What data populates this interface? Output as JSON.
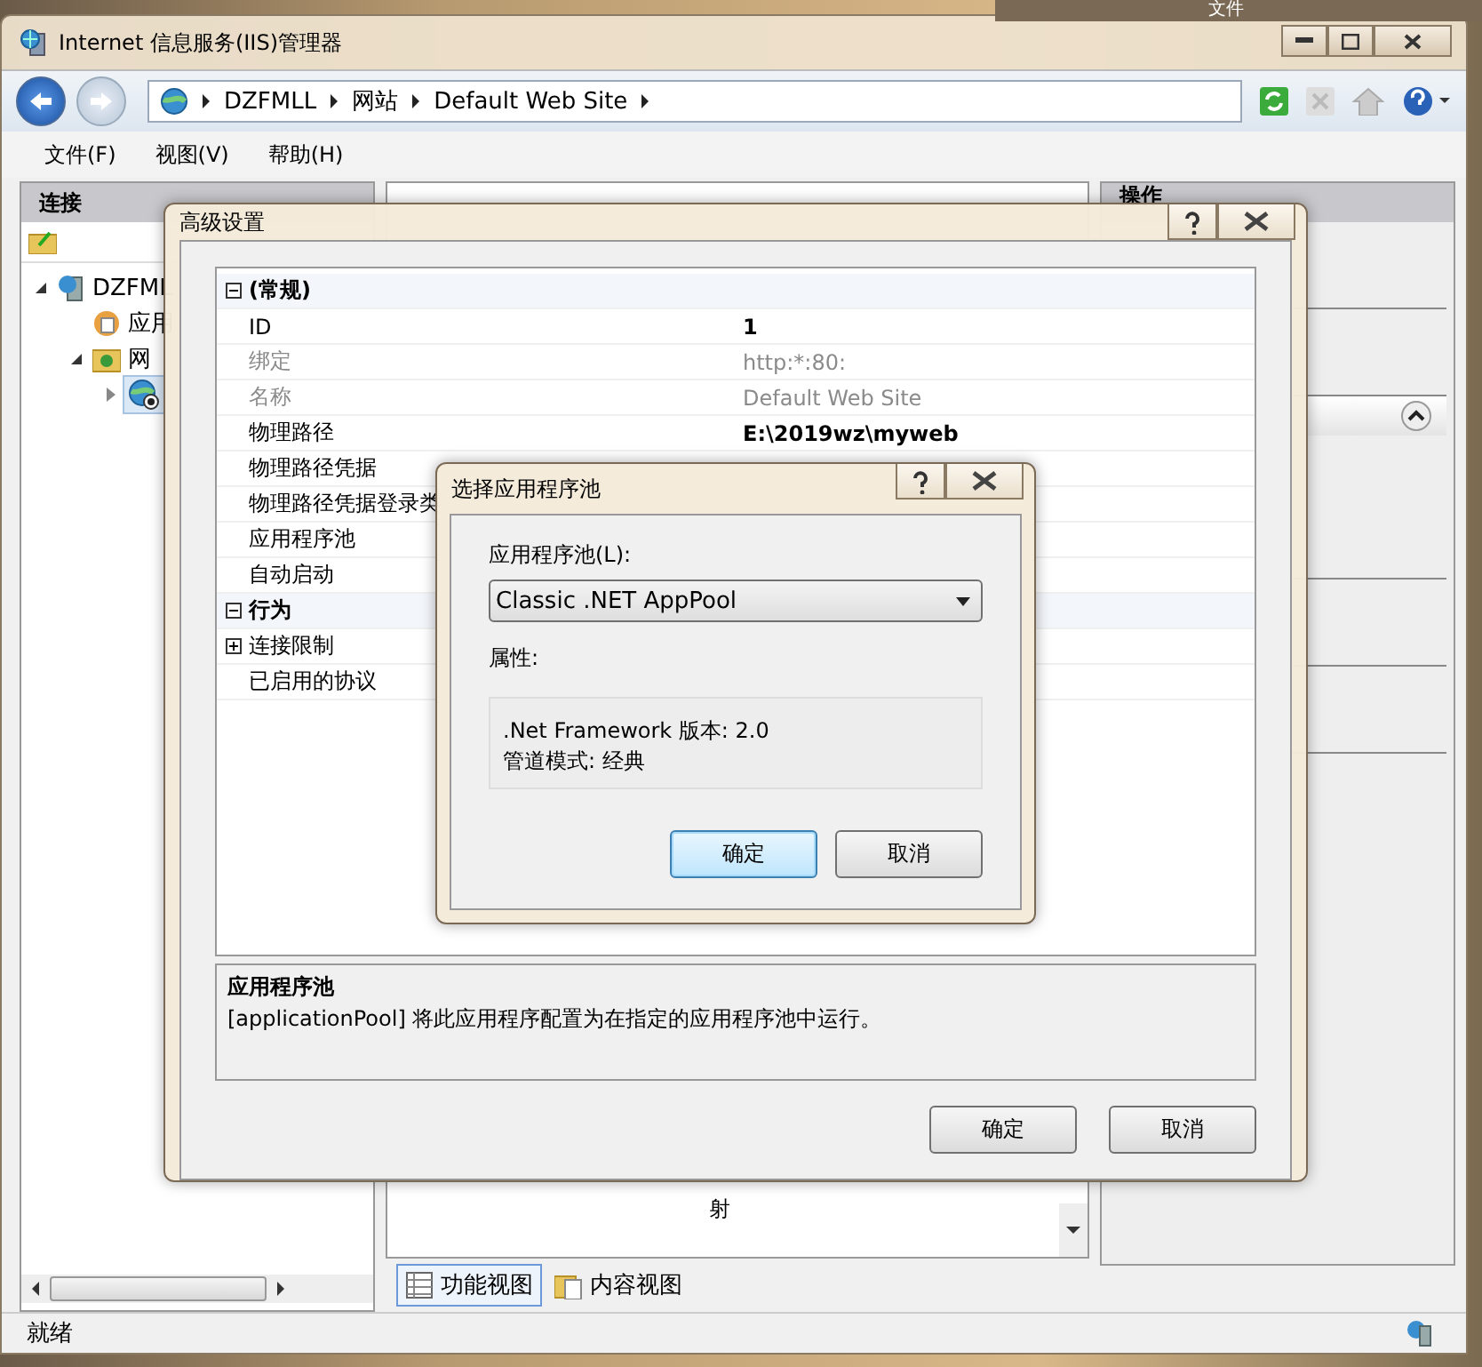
{
  "background_window": {
    "title": "文件"
  },
  "window": {
    "title": "Internet 信息服务(IIS)管理器"
  },
  "breadcrumb": [
    "DZFMLL",
    "网站",
    "Default Web Site"
  ],
  "menu": [
    "文件(F)",
    "视图(V)",
    "帮助(H)"
  ],
  "connections": {
    "title": "连接",
    "tree": [
      {
        "label": "DZFML",
        "kind": "server",
        "expanded": true,
        "selected": false,
        "children": [
          {
            "label": "应用",
            "kind": "pools",
            "selected": false
          },
          {
            "label": "网",
            "kind": "sites",
            "expanded": true,
            "selected": false,
            "children": [
              {
                "kind": "site",
                "expanded": false,
                "selected": true
              }
            ]
          }
        ]
      }
    ]
  },
  "center": {
    "feature_label": "射"
  },
  "actions": {
    "title": "操作"
  },
  "view_tabs": [
    {
      "label": "功能视图",
      "selected": true
    },
    {
      "label": "内容视图",
      "selected": false
    }
  ],
  "status_bar": {
    "text": "就绪"
  },
  "advanced_settings": {
    "title": "高级设置",
    "categories": [
      {
        "name": "(常规)",
        "expanded": true,
        "rows": [
          {
            "name": "ID",
            "value": "1",
            "bold": true,
            "disabled": false
          },
          {
            "name": "绑定",
            "value": "http:*:80:",
            "bold": false,
            "disabled": true
          },
          {
            "name": "名称",
            "value": "Default Web Site",
            "bold": false,
            "disabled": true
          },
          {
            "name": "物理路径",
            "value": "E:\\2019wz\\myweb",
            "bold": true,
            "disabled": false
          },
          {
            "name": "物理路径凭据",
            "disabled": false
          },
          {
            "name": "物理路径凭据登录类",
            "disabled": false
          },
          {
            "name": "应用程序池",
            "disabled": false
          },
          {
            "name": "自动启动",
            "disabled": false
          }
        ]
      },
      {
        "name": "行为",
        "expanded": true,
        "rows": [
          {
            "name": "连接限制",
            "disabled": false,
            "expanded": false
          },
          {
            "name": "已启用的协议",
            "disabled": false
          }
        ]
      }
    ],
    "description": {
      "title": "应用程序池",
      "text": "[applicationPool] 将此应用程序配置为在指定的应用程序池中运行。"
    },
    "buttons": [
      "确定",
      "取消"
    ]
  },
  "select_pool": {
    "title": "选择应用程序池",
    "pool_label": "应用程序池(L):",
    "pool_value": "Classic .NET AppPool",
    "properties_label": "属性:",
    "properties": [
      ".Net Framework 版本: 2.0",
      "管道模式: 经典"
    ],
    "buttons": [
      {
        "label": "确定",
        "default": true
      },
      {
        "label": "取消",
        "default": false
      }
    ]
  }
}
